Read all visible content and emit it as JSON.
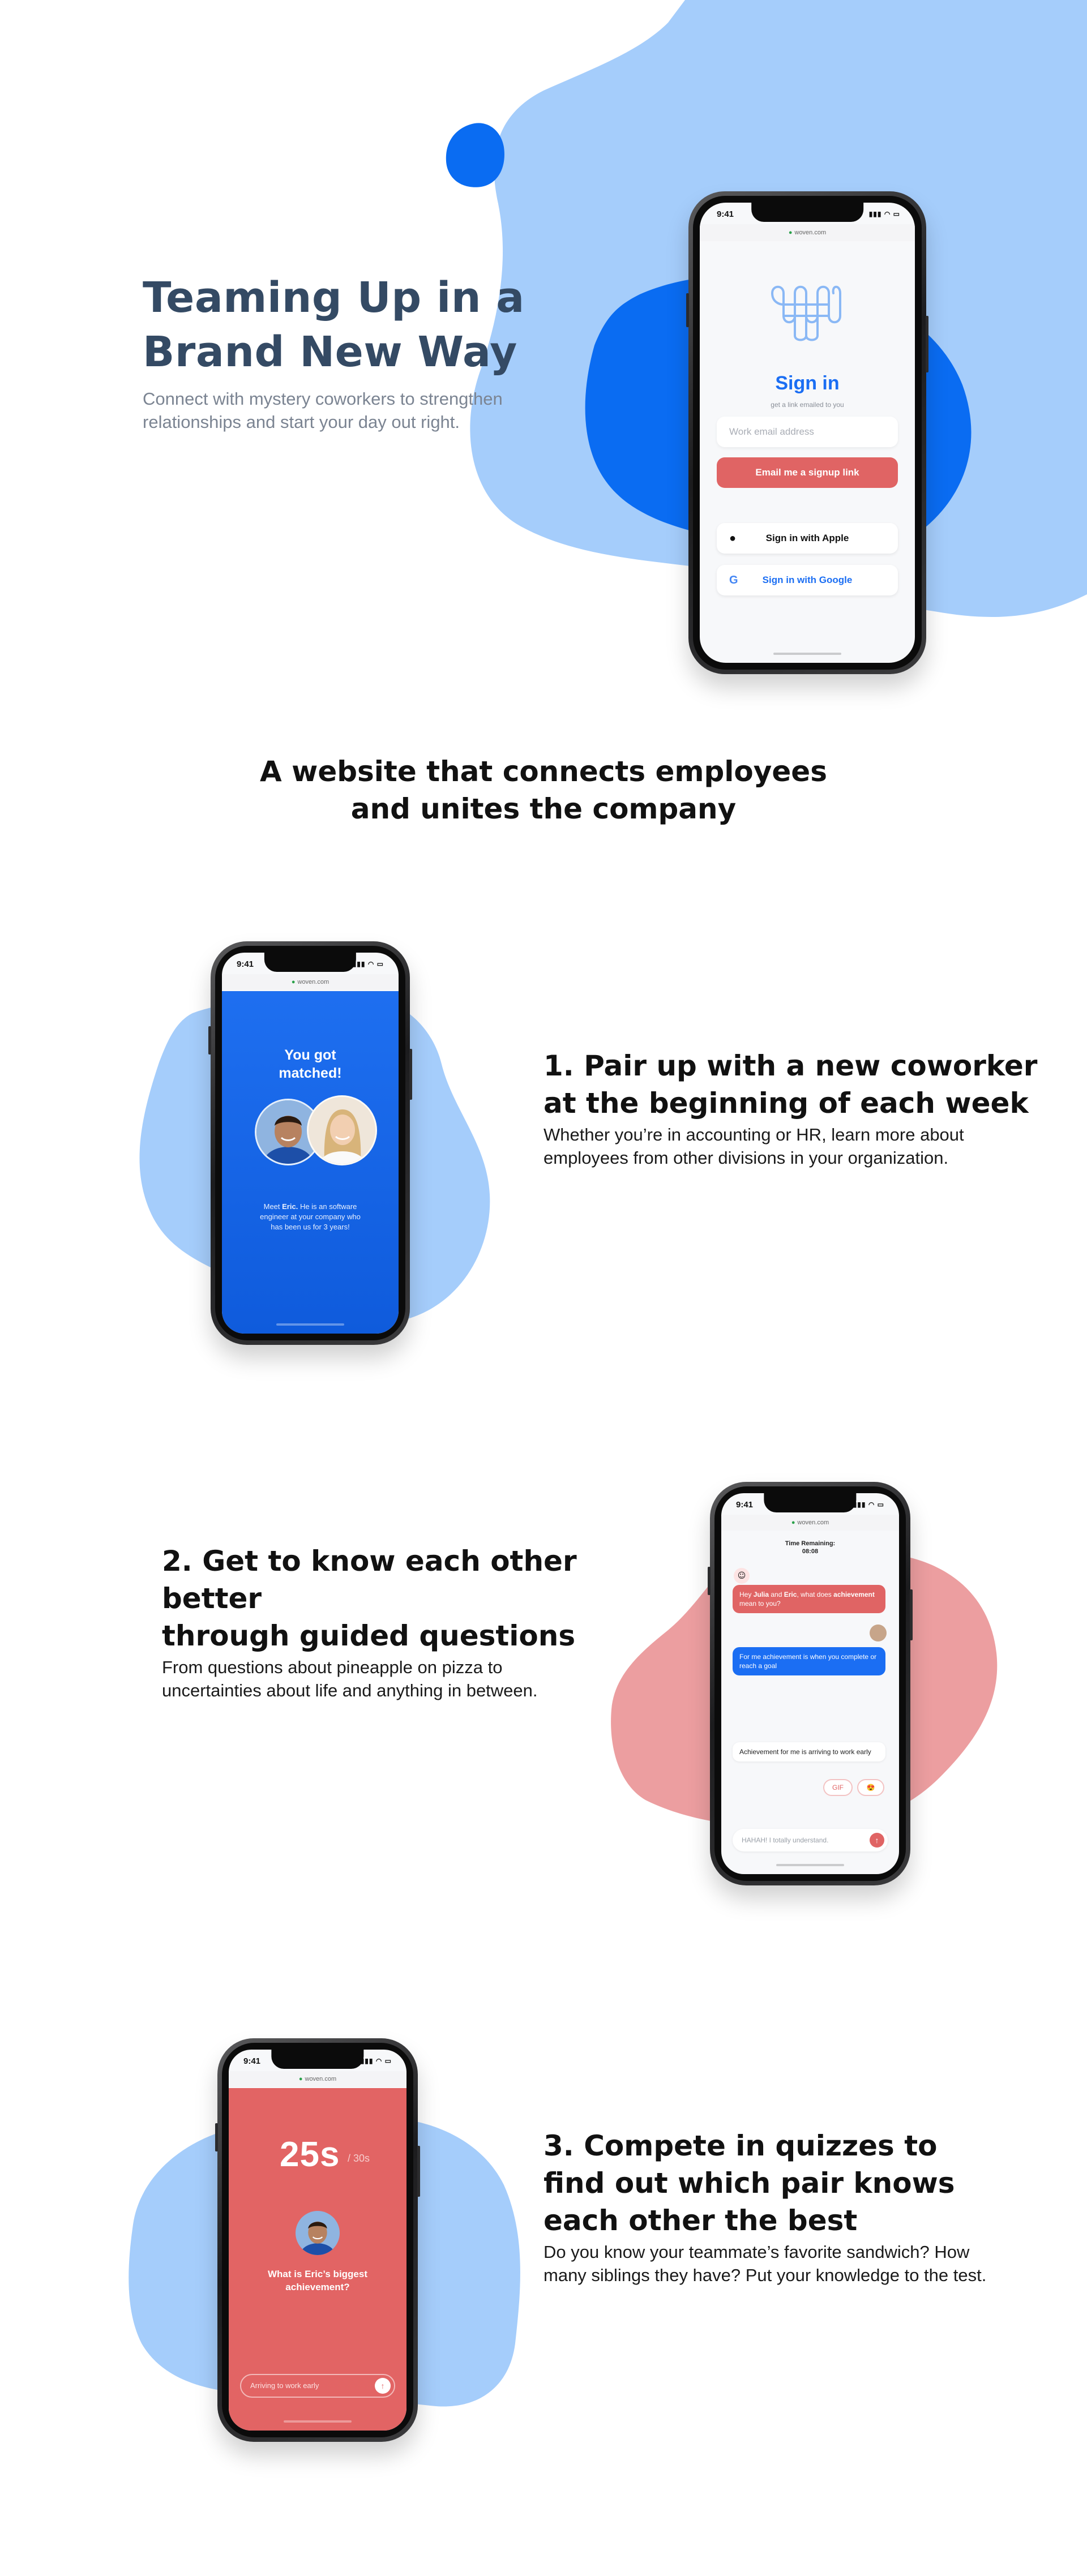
{
  "colors": {
    "light_blue": "#a5cdfb",
    "blue": "#0a6cf2",
    "salmon": "#ec9ea0",
    "red": "#e26464",
    "title_navy": "#344a64"
  },
  "hero": {
    "title": "Teaming Up in a\nBrand New Way",
    "subtitle": "Connect with mystery coworkers to strengthen relationships and start your day out right."
  },
  "section_heading": "A website that connects employees\nand unites the company",
  "features": [
    {
      "title": "1. Pair up with a new coworker\nat the beginning of each week",
      "desc": "Whether you’re in accounting or HR, learn more about\nemployees from other divisions in your organization."
    },
    {
      "title": "2. Get to know each other better\nthrough guided questions",
      "desc": "From questions about pineapple on pizza to\nuncertainties about life and anything in between."
    },
    {
      "title": "3. Compete in quizzes to\nfind out which pair knows\neach other the best",
      "desc": "Do you know your teammate’s favorite sandwich? How\nmany siblings they have? Put your knowledge to the test."
    }
  ],
  "phone_common": {
    "time": "9:41",
    "url": "woven.com",
    "signal": "▮▮▮ ◠ ▭"
  },
  "signin": {
    "title": "Sign in",
    "subtitle": "get a link emailed to you",
    "email_placeholder": "Work email address",
    "email_button": "Email me a signup link",
    "apple_button": "Sign in with Apple",
    "google_button": "Sign in with Google",
    "apple_icon": "apple-icon",
    "google_icon": "google-icon"
  },
  "matched": {
    "title": "You got\nmatched!",
    "text_pre": "Meet ",
    "name": "Eric.",
    "text_post": " He is an software engineer at your company who has been us for 3 years!"
  },
  "chat": {
    "timer_label": "Time Remaining:",
    "timer_value": "08:08",
    "q_pre": "Hey ",
    "q_name1": "Julia",
    "q_mid": " and ",
    "q_name2": "Eric",
    "q_post1": ", what does ",
    "q_bold": "achievement",
    "q_post2": " mean to you?",
    "reply_blue": "For me achievement is when you complete or reach a goal",
    "reply_white": "Achievement for me is arriving to work early",
    "chip_gif": "GIF",
    "chip_emoji": "😍",
    "input_text": "HAHAH! I totally understand."
  },
  "quiz": {
    "timer": "25s",
    "timer_total": "/ 30s",
    "question": "What is Eric’s biggest\nachievement?",
    "answer": "Arriving to work early"
  }
}
